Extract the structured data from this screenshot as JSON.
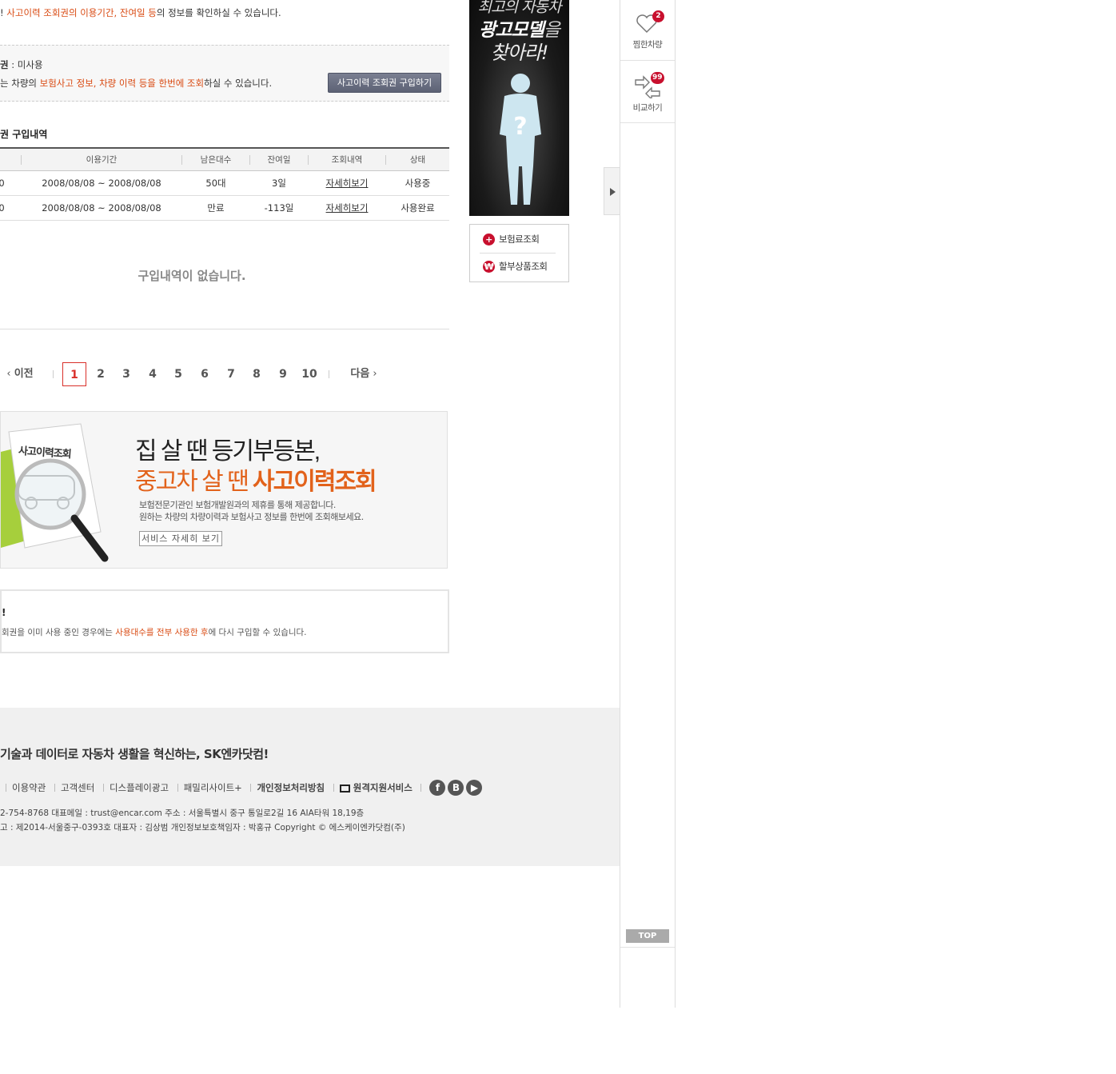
{
  "top_info": {
    "prefix": "!",
    "highlight": "사고이력 조회권의 이용기간, 잔여일 등",
    "suffix": "의 정보를 확인하실 수 있습니다."
  },
  "ticket": {
    "status_label": "권",
    "status_value": " : 미사용",
    "desc_prefix": "는 차량의 ",
    "desc_highlight": "보험사고 정보, 차량 이력 등을 한번에 조회",
    "desc_suffix": "하실 수 있습니다.",
    "buy_button": "사고이력 조회권 구입하기"
  },
  "history": {
    "title": "권 구입내역",
    "columns": [
      "이용기간",
      "남은대수",
      "잔여일",
      "조회내역",
      "상태"
    ],
    "rows": [
      {
        "num": "0",
        "period": "2008/08/08 ~ 2008/08/08",
        "remaining": "50대",
        "days": "3일",
        "detail": "자세히보기",
        "status": "사용중"
      },
      {
        "num": "0",
        "period": "2008/08/08 ~ 2008/08/08",
        "remaining": "만료",
        "days": "-113일",
        "detail": "자세히보기",
        "status": "사용완료"
      }
    ],
    "empty_message": "구입내역이 없습니다."
  },
  "pager": {
    "prev": "이전",
    "next": "다음",
    "pages": [
      "1",
      "2",
      "3",
      "4",
      "5",
      "6",
      "7",
      "8",
      "9",
      "10"
    ],
    "current": "1"
  },
  "banner": {
    "card_label": "사고이력조회",
    "headline1": "집 살 땐 등기부등본,",
    "headline2_prefix": "중고차 살 땐 ",
    "headline2_bold": "사고이력조회",
    "desc1": "보험전문기관인 보험개발원과의 제휴를 통해 제공합니다.",
    "desc2": "원하는 차량의 차량이력과 보험사고 정보를 한번에 조회해보세요.",
    "button": "서비스 자세히 보기"
  },
  "notice": {
    "title": "!",
    "text_prefix": "회권을 이미 사용 중인 경우에는 ",
    "text_highlight": "사용대수를 전부 사용한 후",
    "text_suffix": "에 다시 구입할 수 있습니다."
  },
  "footer": {
    "slogan": "기술과 데이터로 자동차 생활을 혁신하는, SK엔카닷컴!",
    "links": [
      "이용약관",
      "고객센터",
      "디스플레이광고",
      "패밀리사이트+",
      "개인정보처리방침",
      "원격지원서비스"
    ],
    "sns": [
      "facebook-icon",
      "blog-icon",
      "youtube-icon"
    ],
    "info1": "2-754-8768   대표메일 : trust@encar.com   주소 : 서울특별시 중구 통일로2길 16 AIA타워 18,19층",
    "info2": "고 : 제2014-서울중구-0393호   대표자 : 김상범   개인정보보호책임자 : 박홍규   Copyright © 에스케이엔카닷컴(주)"
  },
  "ad": {
    "line1": "최고의 자동차",
    "line2_bold": "광고모델",
    "line2_rest": "을",
    "line3": "찾아라!"
  },
  "quick_links": [
    "보험료조회",
    "할부상품조회"
  ],
  "side": {
    "wish_label": "찜한차량",
    "wish_count": "2",
    "compare_label": "비교하기",
    "compare_count": "99",
    "top_button": "TOP"
  },
  "colors": {
    "accent": "#d94a12",
    "badge": "#c8102e",
    "button": "#6b7083"
  }
}
